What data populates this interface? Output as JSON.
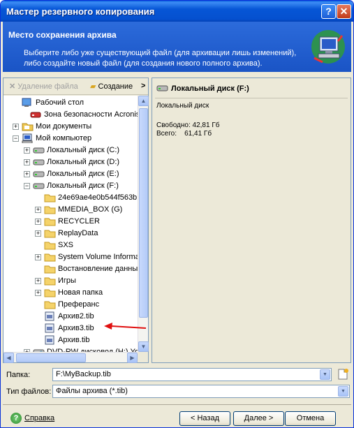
{
  "window": {
    "title": "Мастер резервного копирования",
    "help_btn": "?",
    "close_btn": "✕"
  },
  "header": {
    "title": "Место сохранения архива",
    "description": "Выберите либо уже существующий файл (для архивации лишь изменений), либо создайте новый файл (для создания нового полного архива)."
  },
  "toolbar": {
    "delete_label": "Удаление файла",
    "new_label": "Создание",
    "more": ">"
  },
  "tree": {
    "items": [
      {
        "label": "Рабочий стол",
        "icon": "desktop-icon",
        "expander": ""
      },
      {
        "label": "Зона безопасности Acronis",
        "icon": "acronis-zone-icon",
        "expander": ""
      },
      {
        "label": "Мои документы",
        "icon": "my-documents-icon",
        "expander": "+"
      },
      {
        "label": "Мой компьютер",
        "icon": "my-computer-icon",
        "expander": "−"
      },
      {
        "label": "Локальный диск (C:)",
        "icon": "disk-icon",
        "expander": "+"
      },
      {
        "label": "Локальный диск (D:)",
        "icon": "disk-icon",
        "expander": "+"
      },
      {
        "label": "Локальный диск (E:)",
        "icon": "disk-icon",
        "expander": "+"
      },
      {
        "label": "Локальный диск (F:)",
        "icon": "disk-icon",
        "expander": "−"
      },
      {
        "label": "24e69ae4e0b544f563b",
        "icon": "folder-icon",
        "expander": ""
      },
      {
        "label": "MMEDIA_BOX (G)",
        "icon": "folder-icon",
        "expander": "+"
      },
      {
        "label": "RECYCLER",
        "icon": "folder-icon",
        "expander": "+"
      },
      {
        "label": "ReplayData",
        "icon": "folder-icon",
        "expander": "+"
      },
      {
        "label": "SXS",
        "icon": "folder-icon",
        "expander": ""
      },
      {
        "label": "System Volume Informa",
        "icon": "folder-icon",
        "expander": "+"
      },
      {
        "label": "Востановление данны",
        "icon": "folder-icon",
        "expander": ""
      },
      {
        "label": "Игры",
        "icon": "folder-icon",
        "expander": "+"
      },
      {
        "label": "Новая папка",
        "icon": "folder-icon",
        "expander": "+"
      },
      {
        "label": "Преферанс",
        "icon": "folder-icon",
        "expander": ""
      },
      {
        "label": "Архив2.tib",
        "icon": "tib-file-icon",
        "expander": ""
      },
      {
        "label": "Архив3.tib",
        "icon": "tib-file-icon",
        "expander": ""
      },
      {
        "label": "Архив.tib",
        "icon": "tib-file-icon",
        "expander": ""
      },
      {
        "label": "DVD-RW дисковод (H:) Yo",
        "icon": "dvd-icon",
        "expander": "+"
      }
    ]
  },
  "details": {
    "title": "Локальный диск (F:)",
    "subtitle": "Локальный диск",
    "free": "Свободно: 42,81 Гб",
    "total": "Всего:    61,41 Гб"
  },
  "fields": {
    "folder_label": "Папка:",
    "folder_value": "F:\\MyBackup.tib",
    "filetype_label": "Тип файлов:",
    "filetype_value": "Файлы архива (*.tib)"
  },
  "footer": {
    "help_label": "Справка",
    "back_label": "< Назад",
    "next_label": "Далее >",
    "cancel_label": "Отмена"
  },
  "colors": {
    "title_blue": "#0756d6",
    "header_blue": "#2c6bdb",
    "arrow_red": "#e01010"
  }
}
